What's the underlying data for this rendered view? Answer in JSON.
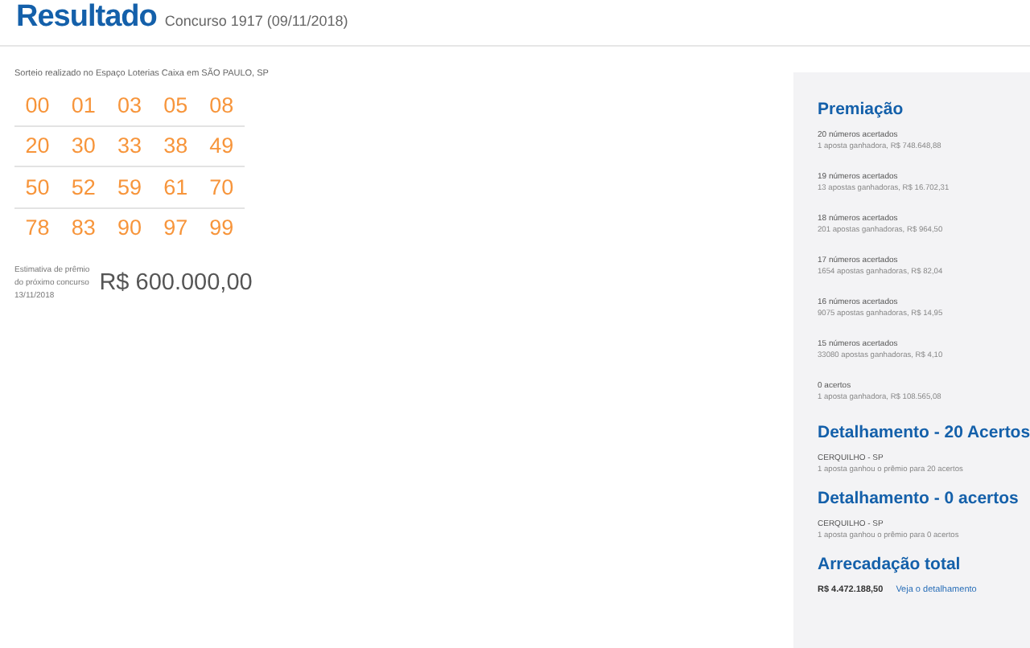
{
  "header": {
    "title": "Resultado",
    "subtitle": "Concurso 1917 (09/11/2018)"
  },
  "draw_location": "Sorteio realizado no Espaço Loterias Caixa em SÃO PAULO, SP",
  "numbers": [
    [
      "00",
      "01",
      "03",
      "05",
      "08"
    ],
    [
      "20",
      "30",
      "33",
      "38",
      "49"
    ],
    [
      "50",
      "52",
      "59",
      "61",
      "70"
    ],
    [
      "78",
      "83",
      "90",
      "97",
      "99"
    ]
  ],
  "estimate": {
    "label_lines": [
      "Estimativa de prêmio",
      "do próximo concurso",
      "13/11/2018"
    ],
    "value": "R$ 600.000,00"
  },
  "sidebar": {
    "prizes_title": "Premiação",
    "prizes": [
      {
        "title": "20 números acertados",
        "detail": "1 aposta ganhadora, R$ 748.648,88"
      },
      {
        "title": "19 números acertados",
        "detail": "13 apostas ganhadoras, R$ 16.702,31"
      },
      {
        "title": "18 números acertados",
        "detail": "201 apostas ganhadoras, R$ 964,50"
      },
      {
        "title": "17 números acertados",
        "detail": "1654 apostas ganhadoras, R$ 82,04"
      },
      {
        "title": "16 números acertados",
        "detail": "9075 apostas ganhadoras, R$ 14,95"
      },
      {
        "title": "15 números acertados",
        "detail": "33080 apostas ganhadoras, R$ 4,10"
      },
      {
        "title": "0 acertos",
        "detail": "1 aposta ganhadora, R$ 108.565,08"
      }
    ],
    "details": [
      {
        "title": "Detalhamento - 20 Acertos",
        "place": "CERQUILHO - SP",
        "text": "1 aposta ganhou o prêmio para 20 acertos"
      },
      {
        "title": "Detalhamento - 0 acertos",
        "place": "CERQUILHO - SP",
        "text": "1 aposta ganhou o prêmio para 0 acertos"
      }
    ],
    "total_title": "Arrecadação total",
    "total_value": "R$ 4.472.188,50",
    "total_link": "Veja o detalhamento"
  }
}
